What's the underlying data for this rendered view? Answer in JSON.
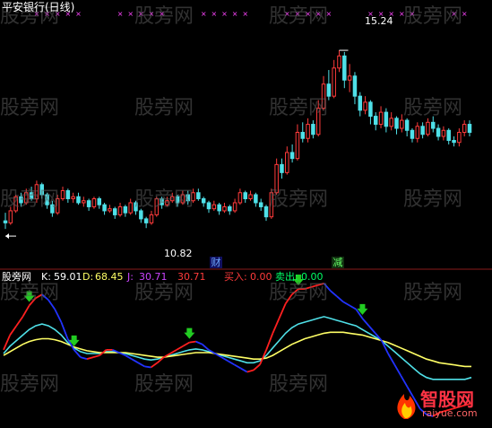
{
  "title": "平安银行(日线)",
  "colors": {
    "up": "#ff3b3b",
    "down": "#4fe0e8",
    "k": "#ffffff",
    "d": "#ffff66",
    "j": "#cc44ff",
    "buy": "#ff3b3b",
    "sell": "#00ff66",
    "marker": "#ff44ff",
    "arrow": "#22cc22"
  },
  "price_panel": {
    "high_label": "15.24",
    "low_label": "10.82",
    "event_labels": [
      "财",
      "减"
    ]
  },
  "indicator_panel": {
    "name": "股旁网",
    "k_label": "K:",
    "k_value": "59.01",
    "d_label": "D:",
    "d_value": "68.45",
    "j_label": "J:",
    "j_value": "30.71",
    "extra_value": "30.71",
    "buy_label": "买入:",
    "buy_value": "0.00",
    "sell_label": "卖出:",
    "sell_value": "0.00"
  },
  "watermark": "股旁网",
  "logo": {
    "brand": "智股网",
    "url": "raiyue.com"
  },
  "chart_data": [
    {
      "type": "candlestick",
      "title": "平安银行(日线)",
      "ylim": [
        10.2,
        16.0
      ],
      "annotations": [
        {
          "text": "15.24",
          "at": "highest high"
        },
        {
          "text": "10.82",
          "at": "lowest low"
        }
      ],
      "candles": [
        [
          11.0,
          10.95,
          11.2,
          10.8
        ],
        [
          10.95,
          11.25,
          11.35,
          10.9
        ],
        [
          11.25,
          11.6,
          11.65,
          11.2
        ],
        [
          11.6,
          11.45,
          11.7,
          11.35
        ],
        [
          11.45,
          11.7,
          11.8,
          11.4
        ],
        [
          11.7,
          11.55,
          11.85,
          11.5
        ],
        [
          11.55,
          11.9,
          12.0,
          11.45
        ],
        [
          11.9,
          11.65,
          11.95,
          11.55
        ],
        [
          11.65,
          11.4,
          11.7,
          11.3
        ],
        [
          11.4,
          11.2,
          11.5,
          11.1
        ],
        [
          11.2,
          11.55,
          11.65,
          11.15
        ],
        [
          11.55,
          11.75,
          11.85,
          11.5
        ],
        [
          11.75,
          11.55,
          11.8,
          11.45
        ],
        [
          11.55,
          11.6,
          11.7,
          11.45
        ],
        [
          11.6,
          11.45,
          11.7,
          11.4
        ],
        [
          11.45,
          11.5,
          11.6,
          11.35
        ],
        [
          11.5,
          11.35,
          11.55,
          11.25
        ],
        [
          11.35,
          11.55,
          11.6,
          11.3
        ],
        [
          11.55,
          11.4,
          11.6,
          11.3
        ],
        [
          11.4,
          11.25,
          11.45,
          11.15
        ],
        [
          11.25,
          11.3,
          11.4,
          11.2
        ],
        [
          11.3,
          11.15,
          11.35,
          11.05
        ],
        [
          11.15,
          11.35,
          11.45,
          11.1
        ],
        [
          11.35,
          11.2,
          11.4,
          11.1
        ],
        [
          11.2,
          11.45,
          11.55,
          11.15
        ],
        [
          11.45,
          11.25,
          11.5,
          11.15
        ],
        [
          11.25,
          11.05,
          11.3,
          10.95
        ],
        [
          11.05,
          10.95,
          11.1,
          10.82
        ],
        [
          10.95,
          11.15,
          11.25,
          10.9
        ],
        [
          11.15,
          11.55,
          11.6,
          11.1
        ],
        [
          11.55,
          11.4,
          11.6,
          11.3
        ],
        [
          11.4,
          11.5,
          11.6,
          11.35
        ],
        [
          11.5,
          11.6,
          11.7,
          11.45
        ],
        [
          11.6,
          11.45,
          11.65,
          11.35
        ],
        [
          11.45,
          11.65,
          11.75,
          11.4
        ],
        [
          11.65,
          11.5,
          11.75,
          11.4
        ],
        [
          11.5,
          11.7,
          11.8,
          11.45
        ],
        [
          11.7,
          11.55,
          11.8,
          11.5
        ],
        [
          11.55,
          11.45,
          11.6,
          11.35
        ],
        [
          11.45,
          11.3,
          11.5,
          11.2
        ],
        [
          11.3,
          11.4,
          11.5,
          11.25
        ],
        [
          11.4,
          11.25,
          11.45,
          11.15
        ],
        [
          11.25,
          11.35,
          11.45,
          11.2
        ],
        [
          11.35,
          11.25,
          11.4,
          11.15
        ],
        [
          11.25,
          11.45,
          11.55,
          11.2
        ],
        [
          11.45,
          11.7,
          11.8,
          11.4
        ],
        [
          11.7,
          11.55,
          11.75,
          11.45
        ],
        [
          11.55,
          11.65,
          11.75,
          11.5
        ],
        [
          11.65,
          11.45,
          11.7,
          11.35
        ],
        [
          11.45,
          11.35,
          11.55,
          11.25
        ],
        [
          11.35,
          11.1,
          11.4,
          11.0
        ],
        [
          11.1,
          11.7,
          11.8,
          11.05
        ],
        [
          11.7,
          12.4,
          12.55,
          11.65
        ],
        [
          12.4,
          12.2,
          12.55,
          12.05
        ],
        [
          12.2,
          12.7,
          12.85,
          12.15
        ],
        [
          12.7,
          12.55,
          12.9,
          12.45
        ],
        [
          12.55,
          13.2,
          13.4,
          12.5
        ],
        [
          13.2,
          13.05,
          13.45,
          12.95
        ],
        [
          13.05,
          13.4,
          13.55,
          12.95
        ],
        [
          13.4,
          13.15,
          13.5,
          13.05
        ],
        [
          13.15,
          13.8,
          14.0,
          13.1
        ],
        [
          13.8,
          14.4,
          14.6,
          13.75
        ],
        [
          14.4,
          14.1,
          14.75,
          14.0
        ],
        [
          14.1,
          14.8,
          15.0,
          14.05
        ],
        [
          14.8,
          15.1,
          15.24,
          14.7
        ],
        [
          15.1,
          14.5,
          15.2,
          14.3
        ],
        [
          14.5,
          14.6,
          14.9,
          14.2
        ],
        [
          14.6,
          14.1,
          14.7,
          13.9
        ],
        [
          14.1,
          13.75,
          14.2,
          13.6
        ],
        [
          13.75,
          13.95,
          14.1,
          13.65
        ],
        [
          13.95,
          13.6,
          14.0,
          13.4
        ],
        [
          13.6,
          13.4,
          13.7,
          13.25
        ],
        [
          13.4,
          13.7,
          13.85,
          13.3
        ],
        [
          13.7,
          13.35,
          13.8,
          13.2
        ],
        [
          13.35,
          13.55,
          13.7,
          13.25
        ],
        [
          13.55,
          13.3,
          13.6,
          13.15
        ],
        [
          13.3,
          13.5,
          13.65,
          13.2
        ],
        [
          13.5,
          13.25,
          13.55,
          13.1
        ],
        [
          13.25,
          13.05,
          13.3,
          12.95
        ],
        [
          13.05,
          13.35,
          13.45,
          12.95
        ],
        [
          13.35,
          13.15,
          13.45,
          13.05
        ],
        [
          13.15,
          13.45,
          13.55,
          13.1
        ],
        [
          13.45,
          13.3,
          13.6,
          13.2
        ],
        [
          13.3,
          13.1,
          13.4,
          13.0
        ],
        [
          13.1,
          13.25,
          13.35,
          13.0
        ],
        [
          13.25,
          13.0,
          13.3,
          12.9
        ],
        [
          13.0,
          12.95,
          13.1,
          12.85
        ],
        [
          12.95,
          13.2,
          13.3,
          12.85
        ],
        [
          13.2,
          13.4,
          13.5,
          13.1
        ],
        [
          13.4,
          13.2,
          13.5,
          13.1
        ]
      ]
    },
    {
      "type": "line",
      "title": "股旁网",
      "ylim": [
        -20,
        120
      ],
      "series": [
        {
          "name": "K",
          "values": [
            50,
            58,
            64,
            70,
            76,
            80,
            82,
            80,
            76,
            70,
            62,
            56,
            52,
            50,
            50,
            50,
            52,
            52,
            51,
            50,
            48,
            46,
            44,
            43,
            44,
            46,
            48,
            50,
            52,
            54,
            55,
            54,
            52,
            50,
            48,
            46,
            44,
            42,
            40,
            40,
            42,
            48,
            56,
            64,
            72,
            78,
            82,
            84,
            86,
            88,
            90,
            88,
            86,
            84,
            82,
            80,
            76,
            72,
            68,
            64,
            58,
            52,
            46,
            40,
            34,
            28,
            24,
            22,
            22,
            22,
            22,
            22,
            22,
            24
          ]
        },
        {
          "name": "D",
          "values": [
            48,
            52,
            56,
            60,
            63,
            65,
            66,
            66,
            65,
            63,
            60,
            57,
            55,
            53,
            52,
            51,
            51,
            51,
            51,
            51,
            50,
            49,
            48,
            47,
            46,
            46,
            47,
            48,
            49,
            50,
            51,
            51,
            51,
            50,
            49,
            48,
            47,
            46,
            45,
            44,
            44,
            45,
            48,
            52,
            56,
            60,
            63,
            66,
            68,
            70,
            72,
            73,
            73,
            73,
            72,
            71,
            70,
            68,
            66,
            64,
            62,
            59,
            56,
            53,
            50,
            47,
            44,
            42,
            40,
            39,
            38,
            37,
            36,
            36
          ]
        },
        {
          "name": "J",
          "values": [
            54,
            70,
            80,
            90,
            102,
            110,
            114,
            108,
            98,
            84,
            66,
            54,
            46,
            44,
            46,
            48,
            54,
            54,
            51,
            48,
            44,
            40,
            36,
            35,
            40,
            46,
            50,
            54,
            58,
            62,
            63,
            60,
            54,
            50,
            46,
            42,
            38,
            34,
            30,
            32,
            38,
            54,
            72,
            88,
            104,
            114,
            120,
            120,
            122,
            124,
            126,
            118,
            112,
            106,
            102,
            98,
            88,
            80,
            72,
            64,
            50,
            38,
            26,
            14,
            2,
            -10,
            -16,
            -18,
            -14,
            -12,
            -10,
            -8,
            -6,
            -4
          ]
        }
      ],
      "signals": [
        {
          "label": "buy",
          "index": 4
        },
        {
          "label": "buy",
          "index": 11
        },
        {
          "label": "buy",
          "index": 29
        },
        {
          "label": "buy",
          "index": 46
        },
        {
          "label": "buy",
          "index": 56
        }
      ]
    }
  ]
}
